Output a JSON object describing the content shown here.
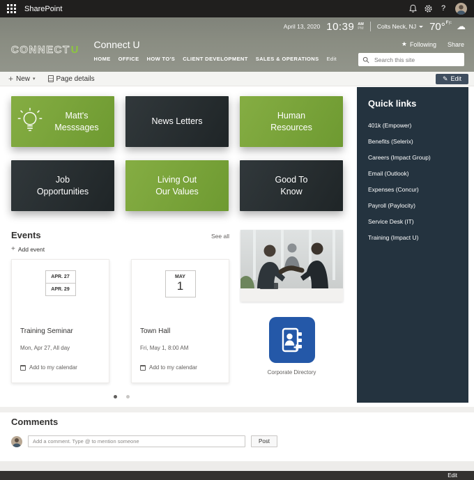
{
  "topbar": {
    "app_name": "SharePoint",
    "help_label": "?"
  },
  "infobar": {
    "date": "April 13, 2020",
    "time": "10:39",
    "meridiem_top": "AM",
    "meridiem_bottom": "PM",
    "location": "Colts Neck, NJ",
    "temperature": "70°",
    "unit_primary": "F",
    "unit_divider": "|",
    "unit_secondary": "c"
  },
  "header": {
    "logo_text": "CONNECT",
    "logo_accent": "U",
    "site_title": "Connect U",
    "nav": [
      {
        "label": "HOME"
      },
      {
        "label": "OFFICE"
      },
      {
        "label": "HOW TO'S"
      },
      {
        "label": "CLIENT DEVELOPMENT"
      },
      {
        "label": "SALES & OPERATIONS"
      },
      {
        "label": "Edit"
      }
    ],
    "following_label": "Following",
    "share_label": "Share",
    "search_placeholder": "Search this site"
  },
  "toolbar": {
    "new_label": "New",
    "page_details_label": "Page details",
    "edit_label": "Edit"
  },
  "tiles": [
    {
      "label": "Matt's Messsages"
    },
    {
      "label": "News Letters"
    },
    {
      "label": "Human Resources"
    },
    {
      "label": "Job Opportunities"
    },
    {
      "label": "Living Out Our Values"
    },
    {
      "label": "Good To Know"
    }
  ],
  "events": {
    "title": "Events",
    "see_all_label": "See all",
    "add_event_label": "Add event",
    "cards": [
      {
        "date_line1": "APR. 27",
        "date_line2": "APR. 29",
        "title": "Training Seminar",
        "when": "Mon, Apr 27, All day",
        "calendar_label": "Add to my calendar"
      },
      {
        "date_month": "MAY",
        "date_day": "1",
        "title": "Town Hall",
        "when": "Fri, May 1, 8:00 AM",
        "calendar_label": "Add to my calendar"
      }
    ]
  },
  "directory": {
    "label": "Corporate Directory"
  },
  "quick_links": {
    "title": "Quick links",
    "links": [
      {
        "label": "401k (Empower)"
      },
      {
        "label": "Benefits (Selerix)"
      },
      {
        "label": "Careers (Impact Group)"
      },
      {
        "label": "Email (Outlook)"
      },
      {
        "label": "Expenses (Concur)"
      },
      {
        "label": "Payroll (Paylocity)"
      },
      {
        "label": "Service Desk (IT)"
      },
      {
        "label": "Training (Impact U)"
      }
    ]
  },
  "comments": {
    "title": "Comments",
    "placeholder": "Add a comment. Type @ to mention someone",
    "post_label": "Post"
  },
  "footer": {
    "edit_label": "Edit"
  },
  "icons": {
    "star": "★",
    "cloud": "☁",
    "caret_down": "▾",
    "pencil": "✎",
    "plus": "+"
  },
  "colors": {
    "accent_green": "#7da33c",
    "tile_dark": "#2a3134",
    "sidebar_dark": "#24333f",
    "directory_blue": "#2458a8",
    "topbar_black": "#201f1e"
  }
}
